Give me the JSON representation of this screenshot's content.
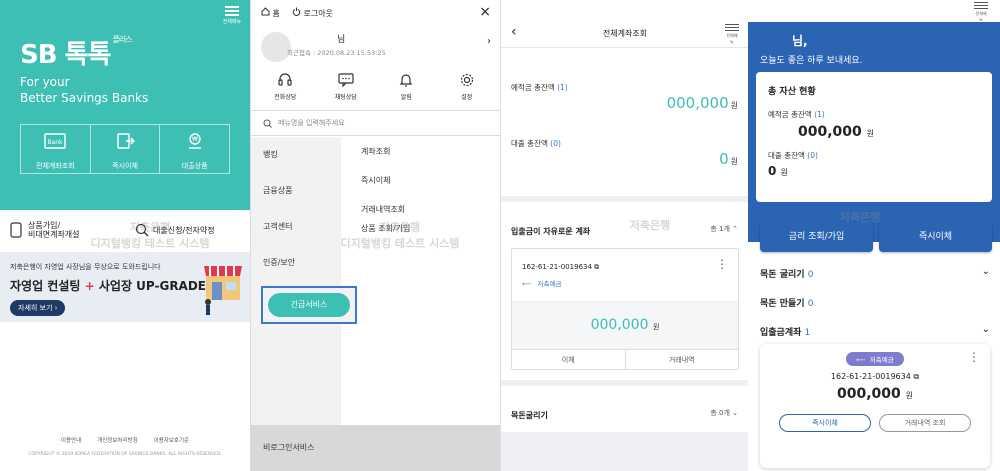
{
  "colors": {
    "teal": "#3ebfb4",
    "blue": "#2a64b3",
    "accent_red": "#e2384d",
    "navy": "#1e3a66"
  },
  "panel1": {
    "menu_label": "전체메뉴",
    "logo_sb": "SB",
    "logo_text": "톡톡",
    "logo_small": "플러스",
    "tagline_1": "For your",
    "tagline_2": "Better Savings Banks",
    "quick": [
      {
        "label": "전체계좌조회",
        "icon": "bank-icon"
      },
      {
        "label": "즉시이체",
        "icon": "transfer-icon"
      },
      {
        "label": "대출상품",
        "icon": "loan-icon"
      }
    ],
    "row_a": "상품가입/\n비대면계좌개설",
    "row_b": "대출신청/전자약정",
    "banner_t1": "저축은행이 자영업 사장님을 무상으로 도와드립니다",
    "banner_t2a": "자영업 컨설팅",
    "banner_plus": "+",
    "banner_t2b": "사업장 UP-GRADE",
    "banner_more": "자세히 보기",
    "banner_more_arrow": "›",
    "footer_links": [
      "이용안내",
      "개인정보처리방침",
      "이용자보호기준"
    ],
    "copyright": "COPYRIGHT © 2019 KOREA FEDERATION OF SAVINGS BANKS. ALL RIGHTS RESERVED."
  },
  "panel2": {
    "home": "홈",
    "logout": "로그아웃",
    "close": "×",
    "name": "님",
    "last_login": "최근접속 : 2020.08.23 15:53:25",
    "chevron": "›",
    "icons": [
      {
        "label": "전화상담",
        "icon": "headset-icon"
      },
      {
        "label": "채팅상담",
        "icon": "chat-icon"
      },
      {
        "label": "알림",
        "icon": "bell-icon"
      },
      {
        "label": "설정",
        "icon": "gear-icon"
      }
    ],
    "search_placeholder": "메뉴명을 입력해주세요",
    "left_nav": [
      "뱅킹",
      "금융상품",
      "고객센터",
      "인증/보안"
    ],
    "urgent": "긴급서비스",
    "sub_nav": [
      "계좌조회",
      "즉시이체",
      "거래내역조회",
      "상품 조회/가입"
    ],
    "bottom": "비로그인서비스"
  },
  "panel3": {
    "back": "‹",
    "title": "전체계좌조회",
    "menu_label": "전체메뉴",
    "deposit_label": "예적금 총잔액",
    "deposit_count": "(1)",
    "deposit_amount": "000,000",
    "won": "원",
    "loan_label": "대출 총잔액",
    "loan_count": "(0)",
    "loan_amount": "0",
    "free_section": "입출금이 자유로운 계좌",
    "free_count": "총 1개",
    "up": "⌃",
    "account_no": "162-61-21-0019634",
    "account_kind": "저축예금",
    "account_balance": "000,000",
    "btn_transfer": "이체",
    "btn_history": "거래내역",
    "lump_section": "목돈굴리기",
    "lump_count": "총 0개",
    "down": "⌄",
    "dots": "⋮"
  },
  "panel4": {
    "menu_label": "전체메뉴",
    "name": "님,",
    "greeting": "오늘도 좋은 하루 보내세요.",
    "assets_title": "총 자산 현황",
    "deposit_label": "예적금 총잔액",
    "deposit_count": "(1)",
    "deposit_amount": "000,000",
    "loan_label": "대출 총잔액",
    "loan_count": "(0)",
    "loan_amount": "0",
    "won": "원",
    "btn_rate": "금리 조회/가입",
    "btn_transfer": "즉시이체",
    "row1": "목돈 굴리기",
    "row1_n": "0",
    "row2": "목돈 만들기",
    "row2_n": "0",
    "row3": "입출금계좌",
    "row3_n": "1",
    "chev": "⌄",
    "badge": "저축예금",
    "account_no": "162-61-21-0019634",
    "balance": "000,000",
    "btn1": "즉시이체",
    "btn2": "거래내역 조회",
    "dots": "⋮"
  },
  "watermark_1": "저축은행",
  "watermark_2": "디지털뱅킹 테스트 시스템"
}
